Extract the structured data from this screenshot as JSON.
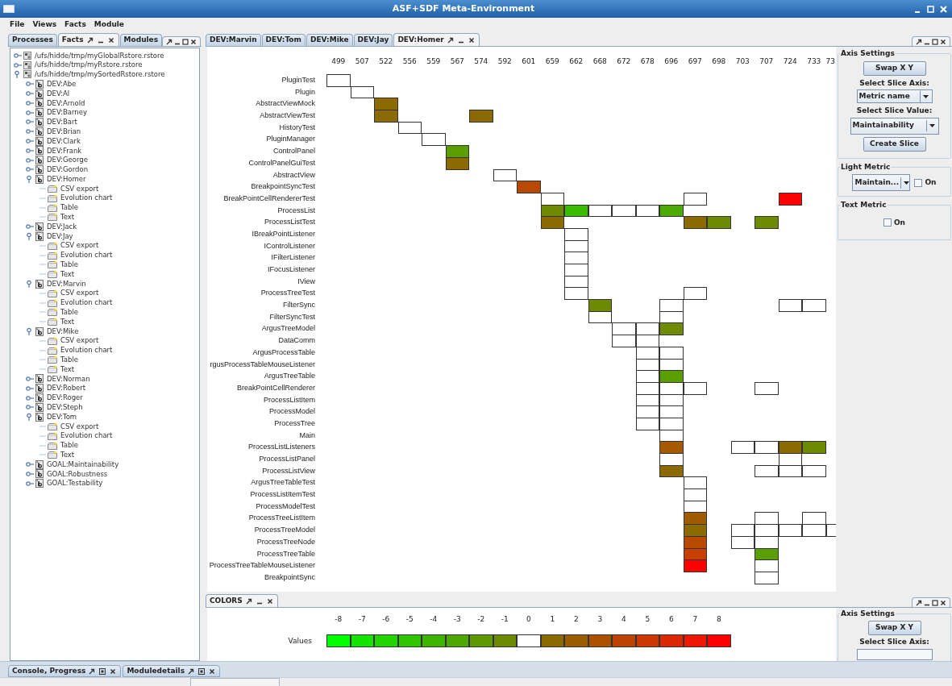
{
  "window": {
    "title": "ASF+SDF Meta-Environment"
  },
  "menu": [
    "File",
    "Views",
    "Facts",
    "Module"
  ],
  "left_panel": {
    "tabs": [
      {
        "label": "Processes",
        "selected": false
      },
      {
        "label": "Facts",
        "selected": true
      },
      {
        "label": "Modules",
        "selected": false
      }
    ],
    "tree": [
      {
        "label": "/ufs/hidde/tmp/myGlobalRstore.rstore",
        "kind": "file",
        "expanded": false
      },
      {
        "label": "/ufs/hidde/tmp/myRstore.rstore",
        "kind": "file",
        "expanded": false
      },
      {
        "label": "/ufs/hidde/tmp/mySortedRstore.rstore",
        "kind": "file",
        "expanded": true,
        "children": [
          {
            "label": "DEV:Abe",
            "kind": "fact",
            "expanded": false
          },
          {
            "label": "DEV:Al",
            "kind": "fact",
            "expanded": false
          },
          {
            "label": "DEV:Arnold",
            "kind": "fact",
            "expanded": false
          },
          {
            "label": "DEV:Barney",
            "kind": "fact",
            "expanded": false
          },
          {
            "label": "DEV:Bart",
            "kind": "fact",
            "expanded": false
          },
          {
            "label": "DEV:Brian",
            "kind": "fact",
            "expanded": false
          },
          {
            "label": "DEV:Clark",
            "kind": "fact",
            "expanded": false
          },
          {
            "label": "DEV:Frank",
            "kind": "fact",
            "expanded": false
          },
          {
            "label": "DEV:George",
            "kind": "fact",
            "expanded": false
          },
          {
            "label": "DEV:Gordon",
            "kind": "fact",
            "expanded": false
          },
          {
            "label": "DEV:Homer",
            "kind": "fact",
            "expanded": true,
            "children": [
              {
                "label": "CSV export",
                "kind": "view"
              },
              {
                "label": "Evolution chart",
                "kind": "view"
              },
              {
                "label": "Table",
                "kind": "view"
              },
              {
                "label": "Text",
                "kind": "view"
              }
            ]
          },
          {
            "label": "DEV:Jack",
            "kind": "fact",
            "expanded": false
          },
          {
            "label": "DEV:Jay",
            "kind": "fact",
            "expanded": true,
            "children": [
              {
                "label": "CSV export",
                "kind": "view"
              },
              {
                "label": "Evolution chart",
                "kind": "view"
              },
              {
                "label": "Table",
                "kind": "view"
              },
              {
                "label": "Text",
                "kind": "view"
              }
            ]
          },
          {
            "label": "DEV:Marvin",
            "kind": "fact",
            "expanded": true,
            "children": [
              {
                "label": "CSV export",
                "kind": "view"
              },
              {
                "label": "Evolution chart",
                "kind": "view"
              },
              {
                "label": "Table",
                "kind": "view"
              },
              {
                "label": "Text",
                "kind": "view"
              }
            ]
          },
          {
            "label": "DEV:Mike",
            "kind": "fact",
            "expanded": true,
            "children": [
              {
                "label": "CSV export",
                "kind": "view"
              },
              {
                "label": "Evolution chart",
                "kind": "view"
              },
              {
                "label": "Table",
                "kind": "view"
              },
              {
                "label": "Text",
                "kind": "view"
              }
            ]
          },
          {
            "label": "DEV:Norman",
            "kind": "fact",
            "expanded": false
          },
          {
            "label": "DEV:Robert",
            "kind": "fact",
            "expanded": false
          },
          {
            "label": "DEV:Roger",
            "kind": "fact",
            "expanded": false
          },
          {
            "label": "DEV:Steph",
            "kind": "fact",
            "expanded": false
          },
          {
            "label": "DEV:Tom",
            "kind": "fact",
            "expanded": true,
            "children": [
              {
                "label": "CSV export",
                "kind": "view"
              },
              {
                "label": "Evolution chart",
                "kind": "view"
              },
              {
                "label": "Table",
                "kind": "view"
              },
              {
                "label": "Text",
                "kind": "view"
              }
            ]
          },
          {
            "label": "GOAL:Maintainability",
            "kind": "fact",
            "expanded": false
          },
          {
            "label": "GOAL:Robustness",
            "kind": "fact",
            "expanded": false
          },
          {
            "label": "GOAL:Testability",
            "kind": "fact",
            "expanded": false
          }
        ]
      }
    ]
  },
  "editor": {
    "tabs": [
      {
        "label": "DEV:Marvin",
        "selected": false
      },
      {
        "label": "DEV:Tom",
        "selected": false
      },
      {
        "label": "DEV:Mike",
        "selected": false
      },
      {
        "label": "DEV:Jay",
        "selected": false
      },
      {
        "label": "DEV:Homer",
        "selected": true
      }
    ],
    "matrix": {
      "columns": [
        "499",
        "507",
        "522",
        "556",
        "559",
        "567",
        "574",
        "592",
        "601",
        "659",
        "662",
        "668",
        "672",
        "678",
        "696",
        "697",
        "698",
        "703",
        "707",
        "724",
        "733",
        "73"
      ],
      "rows": [
        {
          "label": "PluginTest",
          "cells": [
            {
              "color": "#ffffff"
            }
          ]
        },
        {
          "label": "Plugin",
          "cells": [
            null,
            {
              "color": "#ffffff"
            }
          ]
        },
        {
          "label": "AbstractViewMock",
          "cells": [
            null,
            null,
            {
              "color": "#8b6b00"
            }
          ]
        },
        {
          "label": "AbstractViewTest",
          "cells": [
            null,
            null,
            {
              "color": "#8b6b00"
            },
            null,
            null,
            null,
            {
              "color": "#8b6b00"
            }
          ]
        },
        {
          "label": "HistoryTest",
          "cells": [
            null,
            null,
            null,
            {
              "color": "#ffffff"
            }
          ]
        },
        {
          "label": "PluginManager",
          "cells": [
            null,
            null,
            null,
            null,
            {
              "color": "#ffffff"
            }
          ]
        },
        {
          "label": "ControlPanel",
          "cells": [
            null,
            null,
            null,
            null,
            null,
            {
              "color": "#5a9e00"
            }
          ]
        },
        {
          "label": "ControlPanelGuiTest",
          "cells": [
            null,
            null,
            null,
            null,
            null,
            {
              "color": "#8b6b00"
            }
          ]
        },
        {
          "label": "AbstractView",
          "cells": [
            null,
            null,
            null,
            null,
            null,
            null,
            null,
            {
              "color": "#ffffff"
            }
          ]
        },
        {
          "label": "BreakpointSyncTest",
          "cells": [
            null,
            null,
            null,
            null,
            null,
            null,
            null,
            null,
            {
              "color": "#b84a00"
            }
          ]
        },
        {
          "label": "BreakPointCellRendererTest",
          "cells": [
            null,
            null,
            null,
            null,
            null,
            null,
            null,
            null,
            null,
            {
              "color": "#ffffff"
            },
            null,
            null,
            null,
            null,
            null,
            {
              "color": "#ffffff"
            },
            null,
            null,
            null,
            {
              "color": "#ff0000"
            }
          ]
        },
        {
          "label": "ProcessList",
          "cells": [
            null,
            null,
            null,
            null,
            null,
            null,
            null,
            null,
            null,
            {
              "color": "#6e8a00"
            },
            {
              "color": "#3cbc00"
            },
            {
              "color": "#ffffff"
            },
            {
              "color": "#ffffff"
            },
            {
              "color": "#ffffff"
            },
            {
              "color": "#4caa00"
            }
          ]
        },
        {
          "label": "ProcessListTest",
          "cells": [
            null,
            null,
            null,
            null,
            null,
            null,
            null,
            null,
            null,
            {
              "color": "#8b6b00"
            },
            null,
            null,
            null,
            null,
            null,
            {
              "color": "#8b6b00"
            },
            {
              "color": "#6e8a00"
            },
            null,
            {
              "color": "#6e8a00"
            }
          ]
        },
        {
          "label": "IBreakPointListener",
          "cells": [
            null,
            null,
            null,
            null,
            null,
            null,
            null,
            null,
            null,
            null,
            {
              "color": "#ffffff"
            }
          ]
        },
        {
          "label": "IControlListener",
          "cells": [
            null,
            null,
            null,
            null,
            null,
            null,
            null,
            null,
            null,
            null,
            {
              "color": "#ffffff"
            }
          ]
        },
        {
          "label": "IFilterListener",
          "cells": [
            null,
            null,
            null,
            null,
            null,
            null,
            null,
            null,
            null,
            null,
            {
              "color": "#ffffff"
            }
          ]
        },
        {
          "label": "IFocusListener",
          "cells": [
            null,
            null,
            null,
            null,
            null,
            null,
            null,
            null,
            null,
            null,
            {
              "color": "#ffffff"
            }
          ]
        },
        {
          "label": "IView",
          "cells": [
            null,
            null,
            null,
            null,
            null,
            null,
            null,
            null,
            null,
            null,
            {
              "color": "#ffffff"
            }
          ]
        },
        {
          "label": "ProcessTreeTest",
          "cells": [
            null,
            null,
            null,
            null,
            null,
            null,
            null,
            null,
            null,
            null,
            {
              "color": "#ffffff"
            },
            null,
            null,
            null,
            null,
            {
              "color": "#ffffff"
            }
          ]
        },
        {
          "label": "FilterSync",
          "cells": [
            null,
            null,
            null,
            null,
            null,
            null,
            null,
            null,
            null,
            null,
            null,
            {
              "color": "#6e8a00"
            },
            null,
            null,
            {
              "color": "#ffffff"
            },
            null,
            null,
            null,
            null,
            {
              "color": "#ffffff"
            },
            {
              "color": "#ffffff"
            }
          ]
        },
        {
          "label": "FilterSyncTest",
          "cells": [
            null,
            null,
            null,
            null,
            null,
            null,
            null,
            null,
            null,
            null,
            null,
            {
              "color": "#ffffff"
            },
            null,
            null,
            {
              "color": "#ffffff"
            }
          ]
        },
        {
          "label": "ArgusTreeModel",
          "cells": [
            null,
            null,
            null,
            null,
            null,
            null,
            null,
            null,
            null,
            null,
            null,
            null,
            {
              "color": "#ffffff"
            },
            {
              "color": "#ffffff"
            },
            {
              "color": "#6e8a00"
            }
          ]
        },
        {
          "label": "DataComm",
          "cells": [
            null,
            null,
            null,
            null,
            null,
            null,
            null,
            null,
            null,
            null,
            null,
            null,
            {
              "color": "#ffffff"
            },
            {
              "color": "#ffffff"
            }
          ]
        },
        {
          "label": "ArgusProcessTable",
          "cells": [
            null,
            null,
            null,
            null,
            null,
            null,
            null,
            null,
            null,
            null,
            null,
            null,
            null,
            {
              "color": "#ffffff"
            },
            {
              "color": "#ffffff"
            }
          ]
        },
        {
          "label": "rgusProcessTableMouseListener",
          "cells": [
            null,
            null,
            null,
            null,
            null,
            null,
            null,
            null,
            null,
            null,
            null,
            null,
            null,
            {
              "color": "#ffffff"
            },
            {
              "color": "#ffffff"
            }
          ]
        },
        {
          "label": "ArgusTreeTable",
          "cells": [
            null,
            null,
            null,
            null,
            null,
            null,
            null,
            null,
            null,
            null,
            null,
            null,
            null,
            {
              "color": "#ffffff"
            },
            {
              "color": "#5a9e00"
            }
          ]
        },
        {
          "label": "BreakPointCellRenderer",
          "cells": [
            null,
            null,
            null,
            null,
            null,
            null,
            null,
            null,
            null,
            null,
            null,
            null,
            null,
            {
              "color": "#ffffff"
            },
            {
              "color": "#ffffff"
            },
            {
              "color": "#ffffff"
            },
            null,
            null,
            {
              "color": "#ffffff"
            }
          ]
        },
        {
          "label": "ProcessListItem",
          "cells": [
            null,
            null,
            null,
            null,
            null,
            null,
            null,
            null,
            null,
            null,
            null,
            null,
            null,
            {
              "color": "#ffffff"
            },
            {
              "color": "#ffffff"
            }
          ]
        },
        {
          "label": "ProcessModel",
          "cells": [
            null,
            null,
            null,
            null,
            null,
            null,
            null,
            null,
            null,
            null,
            null,
            null,
            null,
            {
              "color": "#ffffff"
            },
            {
              "color": "#ffffff"
            }
          ]
        },
        {
          "label": "ProcessTree",
          "cells": [
            null,
            null,
            null,
            null,
            null,
            null,
            null,
            null,
            null,
            null,
            null,
            null,
            null,
            {
              "color": "#ffffff"
            },
            {
              "color": "#ffffff"
            }
          ]
        },
        {
          "label": "Main",
          "cells": [
            null,
            null,
            null,
            null,
            null,
            null,
            null,
            null,
            null,
            null,
            null,
            null,
            null,
            null,
            {
              "color": "#ffffff"
            }
          ]
        },
        {
          "label": "ProcessListListeners",
          "cells": [
            null,
            null,
            null,
            null,
            null,
            null,
            null,
            null,
            null,
            null,
            null,
            null,
            null,
            null,
            {
              "color": "#a65a00"
            },
            null,
            null,
            {
              "color": "#ffffff"
            },
            {
              "color": "#ffffff"
            },
            {
              "color": "#8b6b00"
            },
            {
              "color": "#6e8a00"
            }
          ]
        },
        {
          "label": "ProcessListPanel",
          "cells": [
            null,
            null,
            null,
            null,
            null,
            null,
            null,
            null,
            null,
            null,
            null,
            null,
            null,
            null,
            {
              "color": "#ffffff"
            },
            null,
            null,
            null,
            null,
            {
              "color": "#ffffff"
            }
          ]
        },
        {
          "label": "ProcessListView",
          "cells": [
            null,
            null,
            null,
            null,
            null,
            null,
            null,
            null,
            null,
            null,
            null,
            null,
            null,
            null,
            {
              "color": "#8b6b00"
            },
            null,
            null,
            null,
            {
              "color": "#ffffff"
            },
            {
              "color": "#ffffff"
            },
            {
              "color": "#ffffff"
            }
          ]
        },
        {
          "label": "ArgusTreeTableTest",
          "cells": [
            null,
            null,
            null,
            null,
            null,
            null,
            null,
            null,
            null,
            null,
            null,
            null,
            null,
            null,
            null,
            {
              "color": "#ffffff"
            }
          ]
        },
        {
          "label": "ProcessListItemTest",
          "cells": [
            null,
            null,
            null,
            null,
            null,
            null,
            null,
            null,
            null,
            null,
            null,
            null,
            null,
            null,
            null,
            {
              "color": "#ffffff"
            }
          ]
        },
        {
          "label": "ProcessModelTest",
          "cells": [
            null,
            null,
            null,
            null,
            null,
            null,
            null,
            null,
            null,
            null,
            null,
            null,
            null,
            null,
            null,
            {
              "color": "#ffffff"
            }
          ]
        },
        {
          "label": "ProcessTreeListItem",
          "cells": [
            null,
            null,
            null,
            null,
            null,
            null,
            null,
            null,
            null,
            null,
            null,
            null,
            null,
            null,
            null,
            {
              "color": "#a05a00"
            },
            null,
            null,
            {
              "color": "#ffffff"
            },
            null,
            {
              "color": "#ffffff"
            }
          ]
        },
        {
          "label": "ProcessTreeModel",
          "cells": [
            null,
            null,
            null,
            null,
            null,
            null,
            null,
            null,
            null,
            null,
            null,
            null,
            null,
            null,
            null,
            {
              "color": "#8b6b00"
            },
            null,
            {
              "color": "#ffffff"
            },
            {
              "color": "#ffffff"
            },
            {
              "color": "#ffffff"
            },
            {
              "color": "#ffffff"
            },
            {
              "color": "#ffffff"
            }
          ]
        },
        {
          "label": "ProcessTreeNode",
          "cells": [
            null,
            null,
            null,
            null,
            null,
            null,
            null,
            null,
            null,
            null,
            null,
            null,
            null,
            null,
            null,
            {
              "color": "#b84a00"
            },
            null,
            {
              "color": "#ffffff"
            },
            {
              "color": "#ffffff"
            }
          ]
        },
        {
          "label": "ProcessTreeTable",
          "cells": [
            null,
            null,
            null,
            null,
            null,
            null,
            null,
            null,
            null,
            null,
            null,
            null,
            null,
            null,
            null,
            {
              "color": "#c84000"
            },
            null,
            null,
            {
              "color": "#5a9e00"
            }
          ]
        },
        {
          "label": "ProcessTreeTableMouseListener",
          "cells": [
            null,
            null,
            null,
            null,
            null,
            null,
            null,
            null,
            null,
            null,
            null,
            null,
            null,
            null,
            null,
            {
              "color": "#ff0000"
            },
            null,
            null,
            {
              "color": "#ffffff"
            }
          ]
        },
        {
          "label": "BreakpointSync",
          "cells": [
            null,
            null,
            null,
            null,
            null,
            null,
            null,
            null,
            null,
            null,
            null,
            null,
            null,
            null,
            null,
            null,
            null,
            null,
            {
              "color": "#ffffff"
            }
          ]
        }
      ]
    },
    "settings": {
      "axis_settings": {
        "title": "Axis Settings",
        "swap_button": "Swap X Y",
        "slice_axis_label": "Select Slice Axis:",
        "slice_axis_value": "Metric name",
        "slice_value_label": "Select Slice Value:",
        "slice_value": "Maintainability",
        "create_button": "Create Slice"
      },
      "light_metric": {
        "title": "Light Metric",
        "value": "Maintain...",
        "checkbox": {
          "label": "On",
          "checked": false
        }
      },
      "text_metric": {
        "title": "Text Metric",
        "checkbox": {
          "label": "On",
          "checked": false
        }
      }
    }
  },
  "colors_panel": {
    "tab": "COLORS",
    "legend": {
      "label": "Values",
      "items": [
        {
          "label": "-8",
          "color": "#00ff00"
        },
        {
          "label": "-7",
          "color": "#16e400"
        },
        {
          "label": "-6",
          "color": "#22d400"
        },
        {
          "label": "-5",
          "color": "#30c400"
        },
        {
          "label": "-4",
          "color": "#3cb400"
        },
        {
          "label": "-3",
          "color": "#4ca800"
        },
        {
          "label": "-2",
          "color": "#5c9a00"
        },
        {
          "label": "-1",
          "color": "#6e8a00"
        },
        {
          "label": "0",
          "color": "#ffffff"
        },
        {
          "label": "1",
          "color": "#8b6b00"
        },
        {
          "label": "2",
          "color": "#9c5c00"
        },
        {
          "label": "3",
          "color": "#ac5000"
        },
        {
          "label": "4",
          "color": "#bc4400"
        },
        {
          "label": "5",
          "color": "#cc3800"
        },
        {
          "label": "6",
          "color": "#dc2800"
        },
        {
          "label": "7",
          "color": "#ec1800"
        },
        {
          "label": "8",
          "color": "#ff0000"
        }
      ]
    },
    "settings": {
      "title": "Axis Settings",
      "swap_button": "Swap X Y",
      "slice_axis_label": "Select Slice Axis:"
    }
  },
  "bottom_tabs": [
    "Console, Progress",
    "Moduledetails"
  ]
}
